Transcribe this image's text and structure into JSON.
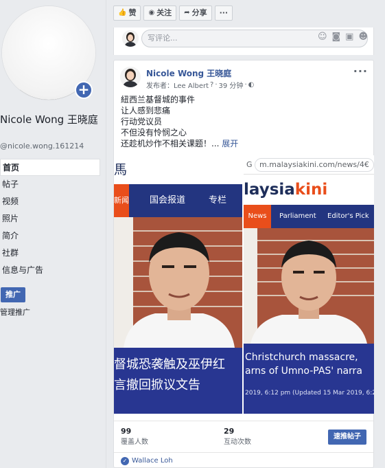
{
  "sidebar": {
    "name": "Nicole Wong 王晓庭",
    "handle": "@nicole.wong.161214",
    "nav": [
      "首页",
      "帖子",
      "视频",
      "照片",
      "简介",
      "社群",
      "信息与广告"
    ],
    "promote_label": "推广",
    "manage_promotions": "管理推广"
  },
  "actions": {
    "like": "赞",
    "follow": "关注",
    "share": "分享",
    "more": "···"
  },
  "comment": {
    "placeholder": "写评论..."
  },
  "post": {
    "author": "Nicole Wong 王晓庭",
    "published_by_label": "发布者：Lee Albert",
    "time": "39 分钟",
    "lines": [
      "紐西兰基督城的事件",
      "让人感到悲痛",
      "行动党议员",
      "不但没有怜悯之心",
      "还趁机炒作不相关课题！..."
    ],
    "expand": "展开",
    "more_icon": "···",
    "stats": [
      {
        "value": "99",
        "label": "覆盖人数"
      },
      {
        "value": "29",
        "label": "互动次数"
      }
    ],
    "boost_label": "速推帖子",
    "liker": "Wallace Loh"
  },
  "screenshot_left": {
    "brand": "馬",
    "nav_news": "新闻",
    "nav_parliament": "国会报道",
    "nav_column": "专栏",
    "headline_1": "督城恐袭触及巫伊红",
    "headline_2": "言撤回掀议文告"
  },
  "screenshot_right": {
    "url": "m.malaysiakini.com/news/4€",
    "url_prefix": "G",
    "brand_a": "laysia",
    "brand_b": "kini",
    "nav": [
      "News",
      "Parliament",
      "Editor's Pick"
    ],
    "headline_1": "Christchurch massacre,",
    "headline_2": "arns of Umno-PAS' narra",
    "date": "2019, 6:12 pm (Updated 15 Mar 2019, 6:21"
  },
  "colors": {
    "facebook_blue": "#4267b2",
    "link_blue": "#385898",
    "news_navy": "#233580",
    "news_orange": "#e94e1b"
  }
}
